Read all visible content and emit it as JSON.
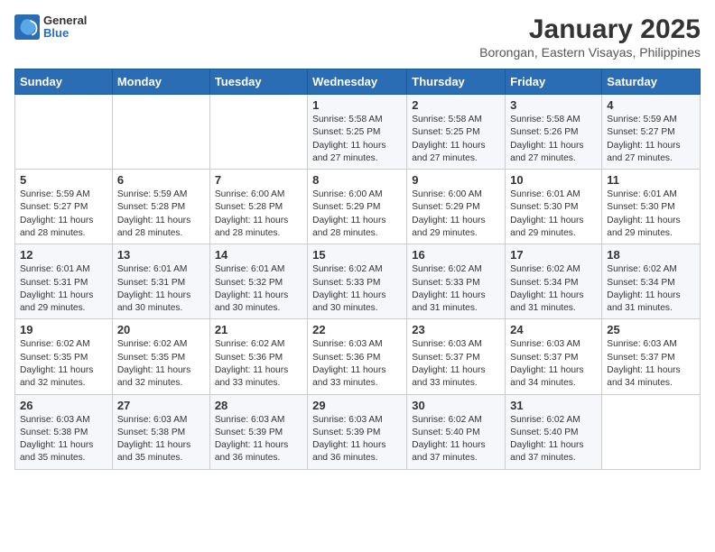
{
  "header": {
    "logo_line1": "General",
    "logo_line2": "Blue",
    "month": "January 2025",
    "location": "Borongan, Eastern Visayas, Philippines"
  },
  "weekdays": [
    "Sunday",
    "Monday",
    "Tuesday",
    "Wednesday",
    "Thursday",
    "Friday",
    "Saturday"
  ],
  "weeks": [
    [
      {
        "day": "",
        "info": ""
      },
      {
        "day": "",
        "info": ""
      },
      {
        "day": "",
        "info": ""
      },
      {
        "day": "1",
        "info": "Sunrise: 5:58 AM\nSunset: 5:25 PM\nDaylight: 11 hours\nand 27 minutes."
      },
      {
        "day": "2",
        "info": "Sunrise: 5:58 AM\nSunset: 5:25 PM\nDaylight: 11 hours\nand 27 minutes."
      },
      {
        "day": "3",
        "info": "Sunrise: 5:58 AM\nSunset: 5:26 PM\nDaylight: 11 hours\nand 27 minutes."
      },
      {
        "day": "4",
        "info": "Sunrise: 5:59 AM\nSunset: 5:27 PM\nDaylight: 11 hours\nand 27 minutes."
      }
    ],
    [
      {
        "day": "5",
        "info": "Sunrise: 5:59 AM\nSunset: 5:27 PM\nDaylight: 11 hours\nand 28 minutes."
      },
      {
        "day": "6",
        "info": "Sunrise: 5:59 AM\nSunset: 5:28 PM\nDaylight: 11 hours\nand 28 minutes."
      },
      {
        "day": "7",
        "info": "Sunrise: 6:00 AM\nSunset: 5:28 PM\nDaylight: 11 hours\nand 28 minutes."
      },
      {
        "day": "8",
        "info": "Sunrise: 6:00 AM\nSunset: 5:29 PM\nDaylight: 11 hours\nand 28 minutes."
      },
      {
        "day": "9",
        "info": "Sunrise: 6:00 AM\nSunset: 5:29 PM\nDaylight: 11 hours\nand 29 minutes."
      },
      {
        "day": "10",
        "info": "Sunrise: 6:01 AM\nSunset: 5:30 PM\nDaylight: 11 hours\nand 29 minutes."
      },
      {
        "day": "11",
        "info": "Sunrise: 6:01 AM\nSunset: 5:30 PM\nDaylight: 11 hours\nand 29 minutes."
      }
    ],
    [
      {
        "day": "12",
        "info": "Sunrise: 6:01 AM\nSunset: 5:31 PM\nDaylight: 11 hours\nand 29 minutes."
      },
      {
        "day": "13",
        "info": "Sunrise: 6:01 AM\nSunset: 5:31 PM\nDaylight: 11 hours\nand 30 minutes."
      },
      {
        "day": "14",
        "info": "Sunrise: 6:01 AM\nSunset: 5:32 PM\nDaylight: 11 hours\nand 30 minutes."
      },
      {
        "day": "15",
        "info": "Sunrise: 6:02 AM\nSunset: 5:33 PM\nDaylight: 11 hours\nand 30 minutes."
      },
      {
        "day": "16",
        "info": "Sunrise: 6:02 AM\nSunset: 5:33 PM\nDaylight: 11 hours\nand 31 minutes."
      },
      {
        "day": "17",
        "info": "Sunrise: 6:02 AM\nSunset: 5:34 PM\nDaylight: 11 hours\nand 31 minutes."
      },
      {
        "day": "18",
        "info": "Sunrise: 6:02 AM\nSunset: 5:34 PM\nDaylight: 11 hours\nand 31 minutes."
      }
    ],
    [
      {
        "day": "19",
        "info": "Sunrise: 6:02 AM\nSunset: 5:35 PM\nDaylight: 11 hours\nand 32 minutes."
      },
      {
        "day": "20",
        "info": "Sunrise: 6:02 AM\nSunset: 5:35 PM\nDaylight: 11 hours\nand 32 minutes."
      },
      {
        "day": "21",
        "info": "Sunrise: 6:02 AM\nSunset: 5:36 PM\nDaylight: 11 hours\nand 33 minutes."
      },
      {
        "day": "22",
        "info": "Sunrise: 6:03 AM\nSunset: 5:36 PM\nDaylight: 11 hours\nand 33 minutes."
      },
      {
        "day": "23",
        "info": "Sunrise: 6:03 AM\nSunset: 5:37 PM\nDaylight: 11 hours\nand 33 minutes."
      },
      {
        "day": "24",
        "info": "Sunrise: 6:03 AM\nSunset: 5:37 PM\nDaylight: 11 hours\nand 34 minutes."
      },
      {
        "day": "25",
        "info": "Sunrise: 6:03 AM\nSunset: 5:37 PM\nDaylight: 11 hours\nand 34 minutes."
      }
    ],
    [
      {
        "day": "26",
        "info": "Sunrise: 6:03 AM\nSunset: 5:38 PM\nDaylight: 11 hours\nand 35 minutes."
      },
      {
        "day": "27",
        "info": "Sunrise: 6:03 AM\nSunset: 5:38 PM\nDaylight: 11 hours\nand 35 minutes."
      },
      {
        "day": "28",
        "info": "Sunrise: 6:03 AM\nSunset: 5:39 PM\nDaylight: 11 hours\nand 36 minutes."
      },
      {
        "day": "29",
        "info": "Sunrise: 6:03 AM\nSunset: 5:39 PM\nDaylight: 11 hours\nand 36 minutes."
      },
      {
        "day": "30",
        "info": "Sunrise: 6:02 AM\nSunset: 5:40 PM\nDaylight: 11 hours\nand 37 minutes."
      },
      {
        "day": "31",
        "info": "Sunrise: 6:02 AM\nSunset: 5:40 PM\nDaylight: 11 hours\nand 37 minutes."
      },
      {
        "day": "",
        "info": ""
      }
    ]
  ]
}
